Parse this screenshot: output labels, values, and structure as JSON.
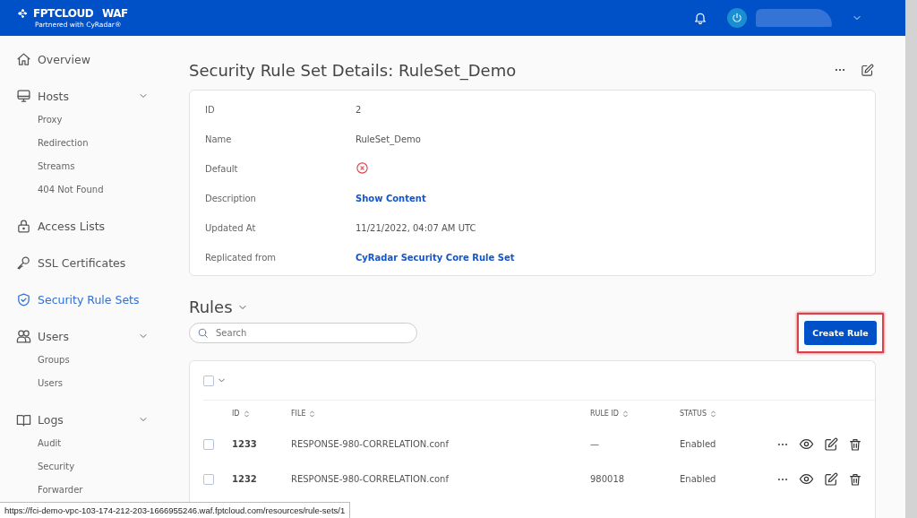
{
  "header": {
    "logo": {
      "brand": "FPTCLOUD",
      "product": "WAF",
      "tagline": "Partnered with CyRadar®"
    }
  },
  "sidebar": {
    "items": [
      {
        "label": "Overview",
        "selected": false
      },
      {
        "label": "Hosts",
        "selected": false,
        "expanded": true,
        "children": [
          {
            "label": "Proxy",
            "selected": false
          },
          {
            "label": "Redirection",
            "selected": false
          },
          {
            "label": "Streams",
            "selected": false
          },
          {
            "label": "404 Not Found",
            "selected": false
          }
        ]
      },
      {
        "label": "Access Lists",
        "selected": false
      },
      {
        "label": "SSL Certificates",
        "selected": false
      },
      {
        "label": "Security Rule Sets",
        "selected": true
      },
      {
        "label": "Users",
        "selected": false,
        "expanded": true,
        "children": [
          {
            "label": "Groups",
            "selected": false
          },
          {
            "label": "Users",
            "selected": false
          }
        ]
      },
      {
        "label": "Logs",
        "selected": false,
        "expanded": true,
        "children": [
          {
            "label": "Audit",
            "selected": false
          },
          {
            "label": "Security",
            "selected": false
          },
          {
            "label": "Forwarder",
            "selected": false
          }
        ]
      }
    ]
  },
  "page": {
    "title": "Security Rule Set Details: RuleSet_Demo"
  },
  "details": [
    {
      "label": "ID",
      "kind": "text",
      "value": "2"
    },
    {
      "label": "Name",
      "kind": "text",
      "value": "RuleSet_Demo"
    },
    {
      "label": "Default",
      "kind": "flag",
      "on": false
    },
    {
      "label": "Description",
      "kind": "link",
      "value": "Show Content"
    },
    {
      "label": "Updated At",
      "kind": "text",
      "value": "11/21/2022, 04:07 AM UTC"
    },
    {
      "label": "Replicated from",
      "kind": "link",
      "value": "CyRadar Security Core Rule Set"
    }
  ],
  "rules": {
    "title": "Rules",
    "search": {
      "placeholder": "Search"
    },
    "create_button": {
      "label": "Create Rule",
      "highlighted": true
    },
    "select_all": {
      "checked": false
    },
    "columns": [
      {
        "label": "ID"
      },
      {
        "label": "FILE"
      },
      {
        "label": "RULE ID"
      },
      {
        "label": "STATUS"
      }
    ],
    "rows": [
      {
        "checked": false,
        "id": "1233",
        "file": "RESPONSE-980-CORRELATION.conf",
        "rule_id": "—",
        "status": "Enabled"
      },
      {
        "checked": false,
        "id": "1232",
        "file": "RESPONSE-980-CORRELATION.conf",
        "rule_id": "980018",
        "status": "Enabled"
      }
    ]
  },
  "status_url": "https://fci-demo-vpc-103-174-212-203-1666955246.waf.fptcloud.com/resources/rule-sets/1"
}
